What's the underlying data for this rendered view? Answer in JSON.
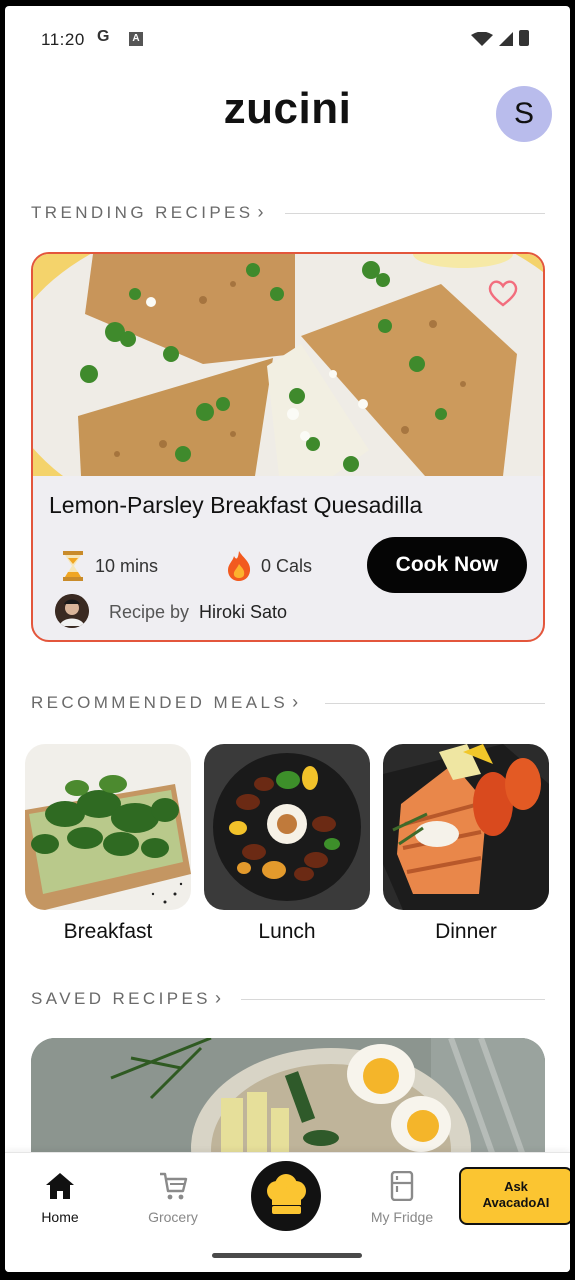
{
  "status_bar": {
    "time": "11:20",
    "g_icon": "G",
    "a_icon": "A"
  },
  "header": {
    "logo": "zucini",
    "avatar_initial": "S"
  },
  "trending": {
    "section_label": "TRENDING RECIPES",
    "chevron": "›",
    "card": {
      "title": "Lemon-Parsley Breakfast Quesadilla",
      "time": "10 mins",
      "calories": "0 Cals",
      "cta": "Cook Now",
      "recipe_by": "Recipe by",
      "author": "Hiroki Sato",
      "favorite_icon": "heart-outline-icon",
      "time_icon": "hourglass-icon",
      "calories_icon": "fire-icon"
    }
  },
  "recommended": {
    "section_label": "RECOMMENDED MEALS",
    "chevron": "›",
    "meals": [
      {
        "label": "Breakfast"
      },
      {
        "label": "Lunch"
      },
      {
        "label": "Dinner"
      }
    ]
  },
  "saved": {
    "section_label": "SAVED RECIPES",
    "chevron": "›"
  },
  "bottom_nav": {
    "items": [
      {
        "label": "Home",
        "icon": "home-icon",
        "active": true
      },
      {
        "label": "Grocery",
        "icon": "cart-icon"
      },
      {
        "label": "",
        "icon": "chef-hat-icon"
      },
      {
        "label": "My Fridge",
        "icon": "fridge-icon"
      }
    ],
    "ask_button": {
      "line1": "Ask",
      "line2": "AvacadoAI"
    }
  },
  "colors": {
    "card_border": "#e3563c",
    "avatar_bg": "#b9bcec",
    "cta_bg": "#050505",
    "ask_bg": "#fbc531",
    "chef_hat": "#fbc531"
  }
}
